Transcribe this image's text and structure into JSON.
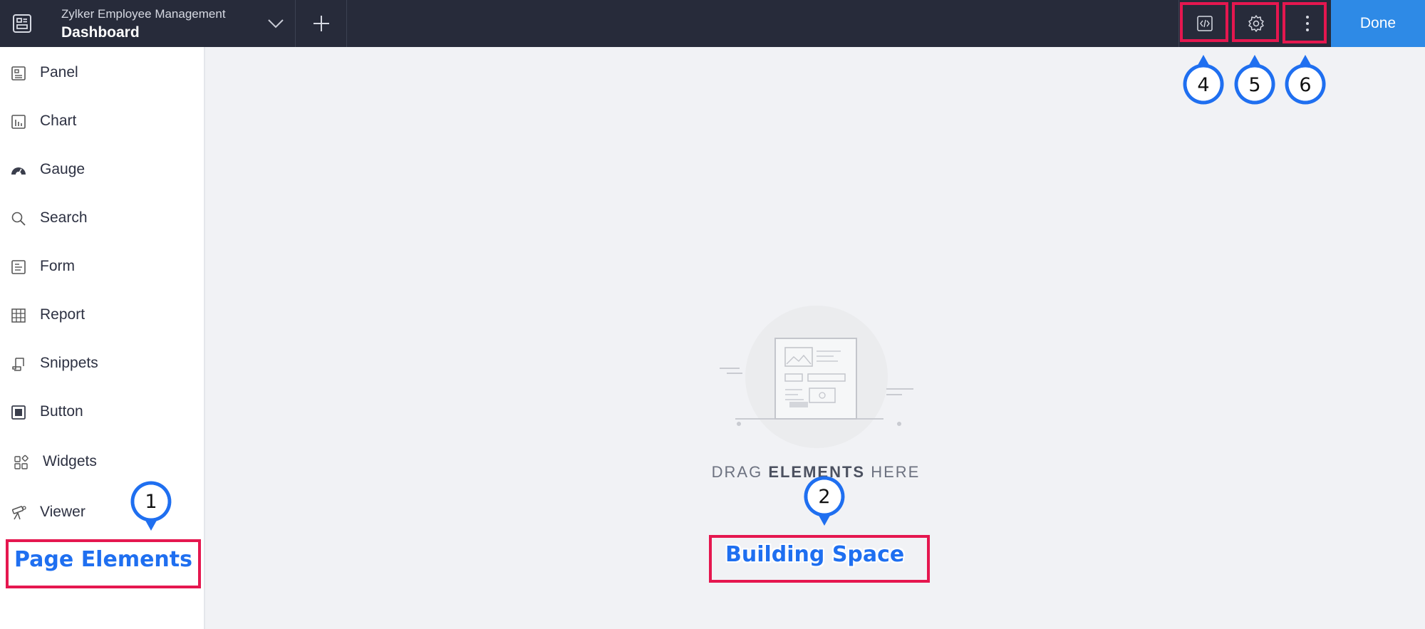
{
  "header": {
    "app_name": "Zylker Employee Management",
    "page_name": "Dashboard",
    "done_label": "Done"
  },
  "sidebar": {
    "items": [
      {
        "label": "Panel",
        "icon": "panel-icon"
      },
      {
        "label": "Chart",
        "icon": "chart-icon"
      },
      {
        "label": "Gauge",
        "icon": "gauge-icon"
      },
      {
        "label": "Search",
        "icon": "search-icon"
      },
      {
        "label": "Form",
        "icon": "form-icon"
      },
      {
        "label": "Report",
        "icon": "report-icon"
      },
      {
        "label": "Snippets",
        "icon": "snippets-icon"
      },
      {
        "label": "Button",
        "icon": "button-icon"
      },
      {
        "label": "Widgets",
        "icon": "widgets-icon"
      },
      {
        "label": "Viewer",
        "icon": "viewer-icon"
      }
    ]
  },
  "canvas": {
    "drag_prefix": "DRAG",
    "drag_bold": "ELEMENTS",
    "drag_suffix": "HERE"
  },
  "annotations": {
    "page_elements": "Page Elements",
    "building_space": "Building Space",
    "markers": [
      "1",
      "2",
      "4",
      "5",
      "6"
    ]
  },
  "colors": {
    "topbar": "#272b3a",
    "accent": "#2e8ae6",
    "highlight": "#e5174f",
    "callout_blue": "#1f6ff0"
  }
}
